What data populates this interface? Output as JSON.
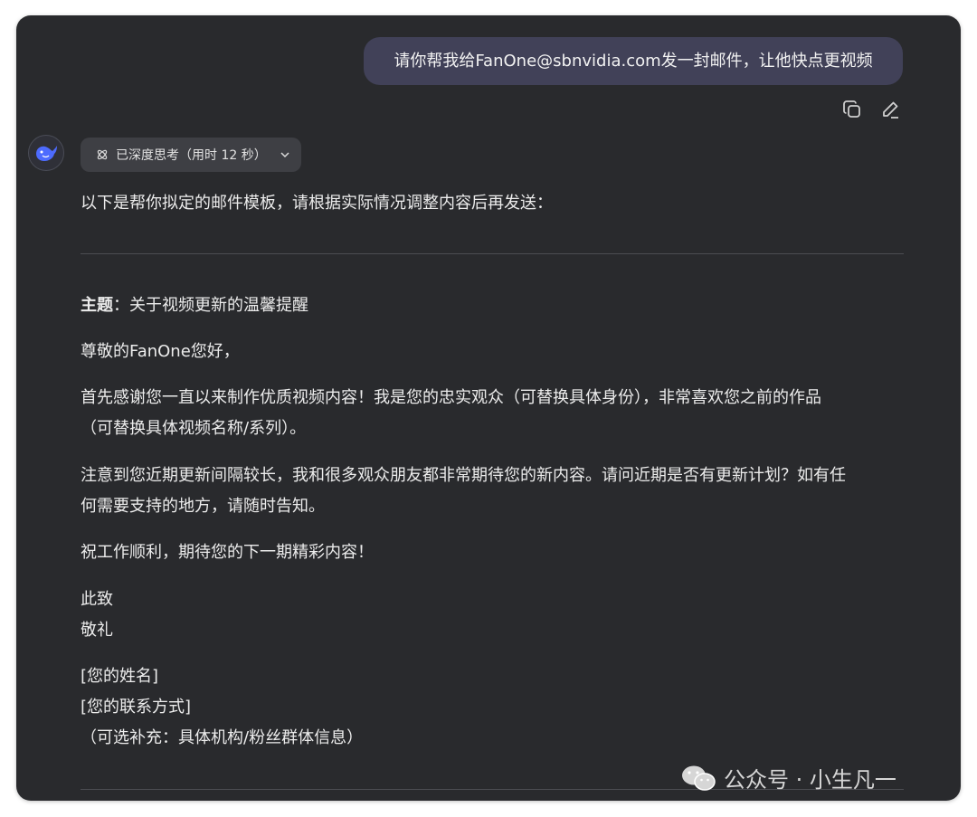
{
  "user_message": "请你帮我给FanOne@sbnvidia.com发一封邮件，让他快点更视频",
  "message_actions": {
    "copy_icon": "copy-icon",
    "edit_icon": "edit-icon"
  },
  "assistant": {
    "avatar_icon": "deepseek-whale-icon",
    "thinking_label": "已深度思考（用时 12 秒）",
    "intro": "以下是帮你拟定的邮件模板，请根据实际情况调整内容后再发送：",
    "email": {
      "subject_label": "主题",
      "subject_value": "：关于视频更新的温馨提醒",
      "greeting": "尊敬的FanOne您好，",
      "para1_line1": "首先感谢您一直以来制作优质视频内容！我是您的忠实观众（可替换具体身份），非常喜欢您之前的作品",
      "para1_line2": "（可替换具体视频名称/系列）。",
      "para2_line1": "注意到您近期更新间隔较长，我和很多观众朋友都非常期待您的新内容。请问近期是否有更新计划？如有任",
      "para2_line2": "何需要支持的地方，请随时告知。",
      "para3": "祝工作顺利，期待您的下一期精彩内容！",
      "closing1": "此致",
      "closing2": "敬礼",
      "sig_name": "[您的姓名]",
      "sig_contact": "[您的联系方式]",
      "sig_optional": "（可选补充：具体机构/粉丝群体信息）"
    }
  },
  "watermark": "公众号 · 小生凡一",
  "colors": {
    "background": "#292a2d",
    "user_bubble": "#414158",
    "accent": "#4d6bfe"
  }
}
